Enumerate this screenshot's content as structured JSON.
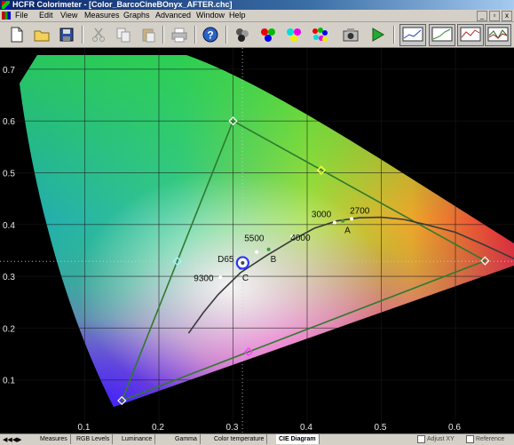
{
  "window": {
    "title": "HCFR Colorimeter - [Color_BarcoCineBOnyx_AFTER.chc]",
    "controls": [
      "_",
      "▫",
      "x"
    ]
  },
  "menu": {
    "items": [
      "File",
      "Edit",
      "View",
      "Measures",
      "Graphs",
      "Advanced",
      "Window",
      "Help"
    ]
  },
  "toolbar": {
    "icons": [
      "new-document",
      "open-folder",
      "save-disk",
      "cut",
      "copy",
      "paste",
      "print",
      "help",
      "measure-gray",
      "measure-primaries",
      "measure-secondaries",
      "measure-all",
      "camera",
      "play",
      "graph-view-1",
      "graph-view-2",
      "graph-view-3",
      "graph-view-4"
    ]
  },
  "chart_data": {
    "type": "scatter",
    "title": "",
    "xlabel": "",
    "ylabel": "",
    "xlim": [
      0.0,
      0.75
    ],
    "ylim": [
      0.0,
      0.75
    ],
    "x_ticks": [
      "0.1",
      "0.2",
      "0.3",
      "0.4",
      "0.5",
      "0.6"
    ],
    "y_ticks": [
      "0.1",
      "0.2",
      "0.3",
      "0.4",
      "0.5",
      "0.6",
      "0.7"
    ],
    "gamut_triangle": {
      "red": [
        0.64,
        0.33
      ],
      "green": [
        0.3,
        0.6
      ],
      "blue": [
        0.15,
        0.06
      ],
      "color": "#2f7a2f"
    },
    "secondaries": [
      {
        "name": "yellow",
        "x": 0.419,
        "y": 0.505,
        "color": "#ffff40"
      },
      {
        "name": "cyan",
        "x": 0.225,
        "y": 0.329,
        "color": "#9ff7ff"
      },
      {
        "name": "magenta",
        "x": 0.321,
        "y": 0.154,
        "color": "#ff40ff"
      }
    ],
    "planckian_locus": {
      "x": [
        0.24,
        0.26,
        0.28,
        0.31,
        0.345,
        0.38,
        0.41,
        0.44,
        0.47,
        0.5,
        0.53,
        0.56,
        0.6,
        0.64,
        0.7
      ],
      "y": [
        0.19,
        0.23,
        0.265,
        0.307,
        0.34,
        0.37,
        0.393,
        0.407,
        0.413,
        0.414,
        0.41,
        0.4,
        0.385,
        0.36,
        0.32
      ]
    },
    "cct_labels": [
      {
        "text": "9300",
        "x": 0.283,
        "y": 0.298
      },
      {
        "text": "D65",
        "x": 0.3127,
        "y": 0.329
      },
      {
        "text": "5500",
        "x": 0.332,
        "y": 0.347
      },
      {
        "text": "4000",
        "x": 0.38,
        "y": 0.377
      },
      {
        "text": "3000",
        "x": 0.437,
        "y": 0.404
      },
      {
        "text": "2700",
        "x": 0.46,
        "y": 0.411
      }
    ],
    "illuminant_labels": [
      {
        "text": "A",
        "x": 0.448,
        "y": 0.407,
        "color": "#3a9a3a"
      },
      {
        "text": "B",
        "x": 0.348,
        "y": 0.352,
        "color": "#3a9a3a"
      },
      {
        "text": "C",
        "x": 0.31,
        "y": 0.316,
        "color": "#3a9a3a"
      }
    ],
    "measured_points": [
      {
        "name": "white-measured",
        "x": 0.313,
        "y": 0.326,
        "color": "#2a36ff"
      }
    ]
  },
  "tabs": {
    "items": [
      "Measures",
      "RGB Levels",
      "Luminance",
      "Gamma",
      "Color temperature",
      "CIE Diagram"
    ],
    "active": "CIE Diagram",
    "right_labels": [
      "Adjust XY",
      "Reference"
    ]
  }
}
